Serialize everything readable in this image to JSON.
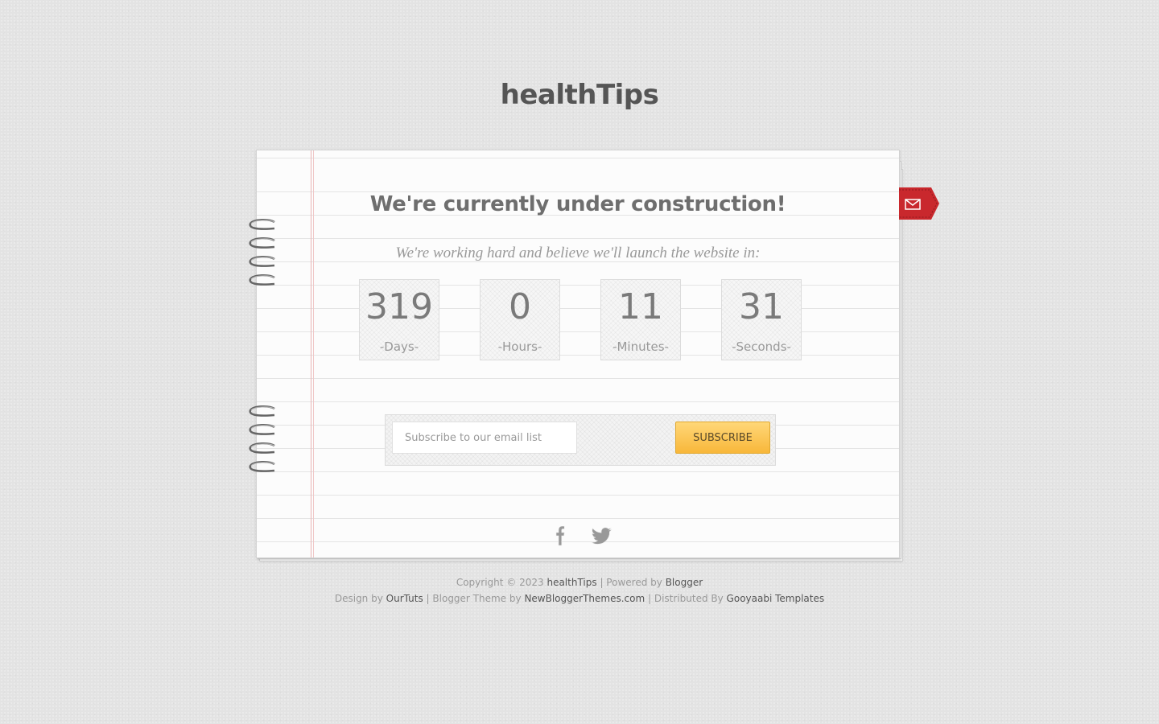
{
  "site": {
    "title": "healthTips"
  },
  "main": {
    "headline": "We're currently under construction!",
    "subline": "We're working hard and believe we'll launch the website in:"
  },
  "countdown": [
    {
      "value": "319",
      "label": "-Days-"
    },
    {
      "value": "0",
      "label": "-Hours-"
    },
    {
      "value": "11",
      "label": "-Minutes-"
    },
    {
      "value": "31",
      "label": "-Seconds-"
    }
  ],
  "subscribe": {
    "placeholder": "Subscribe to our email list",
    "button_label": "SUBSCRIBE"
  },
  "icons": {
    "ribbon": "mail-icon",
    "social": [
      "facebook-icon",
      "twitter-icon"
    ]
  },
  "footer": {
    "line1": {
      "copyright": "Copyright © 2023",
      "site_link": "healthTips",
      "powered_text": "| Powered by",
      "blogger_link": "Blogger"
    },
    "line2": {
      "design_text": "Design by",
      "design_link": "OurTuts",
      "theme_text": "| Blogger Theme by",
      "theme_link": "NewBloggerThemes.com",
      "dist_text": "| Distributed By",
      "dist_link": "Gooyaabi Templates"
    }
  },
  "colors": {
    "background": "#e3e3e3",
    "ribbon": "#c9282d",
    "button": "#f8b73a",
    "margin_line": "#eab4b4"
  }
}
